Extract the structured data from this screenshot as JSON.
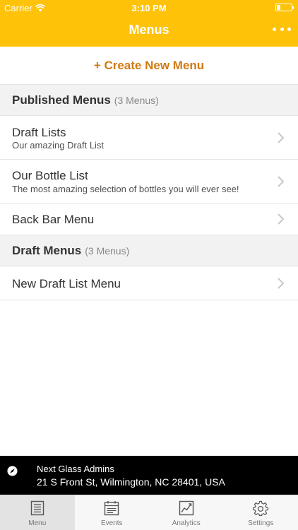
{
  "status_bar": {
    "carrier": "Carrier",
    "time": "3:10 PM"
  },
  "header": {
    "title": "Menus",
    "more_icon": "more-dots-icon"
  },
  "create": {
    "label": "+ Create New Menu"
  },
  "sections": [
    {
      "title": "Published Menus",
      "count": "(3 Menus)",
      "items": [
        {
          "title": "Draft Lists",
          "subtitle": "Our amazing Draft List"
        },
        {
          "title": "Our Bottle List",
          "subtitle": "The most amazing selection of bottles you will ever see!"
        },
        {
          "title": "Back Bar Menu"
        }
      ]
    },
    {
      "title": "Draft Menus",
      "count": "(3 Menus)",
      "items": [
        {
          "title": "New Draft List Menu"
        }
      ]
    }
  ],
  "location": {
    "name": "Next Glass Admins",
    "address": "21 S Front St, Wilmington, NC 28401, USA",
    "icon": "compass-icon"
  },
  "tabs": [
    {
      "label": "Menu",
      "icon": "menu-list-icon",
      "active": true
    },
    {
      "label": "Events",
      "icon": "calendar-icon",
      "active": false
    },
    {
      "label": "Analytics",
      "icon": "analytics-chart-icon",
      "active": false
    },
    {
      "label": "Settings",
      "icon": "gear-icon",
      "active": false
    }
  ],
  "colors": {
    "header": "#fec209",
    "accent": "#d07a11",
    "section_bg": "#f2f2f2",
    "location_bar": "#000000"
  }
}
